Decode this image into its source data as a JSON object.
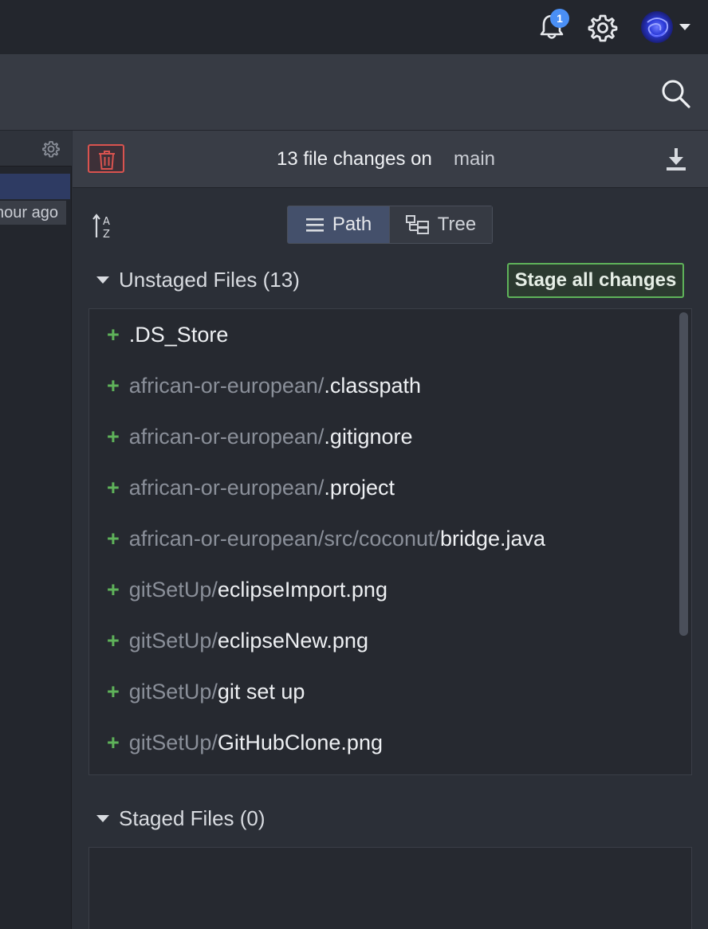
{
  "topbar": {
    "notification_count": "1"
  },
  "panel": {
    "header": {
      "changes_text": "13 file changes on",
      "branch": "main"
    },
    "view_toggle": {
      "path_label": "Path",
      "tree_label": "Tree",
      "active": "Path"
    },
    "unstaged": {
      "title": "Unstaged Files (13)",
      "stage_all_label": "Stage all changes",
      "files": [
        {
          "dir": "",
          "name": ".DS_Store"
        },
        {
          "dir": "african-or-european/",
          "name": ".classpath"
        },
        {
          "dir": "african-or-european/",
          "name": ".gitignore"
        },
        {
          "dir": "african-or-european/",
          "name": ".project"
        },
        {
          "dir": "african-or-european/src/coconut/",
          "name": "bridge.java"
        },
        {
          "dir": "gitSetUp/",
          "name": "eclipseImport.png"
        },
        {
          "dir": "gitSetUp/",
          "name": "eclipseNew.png"
        },
        {
          "dir": "gitSetUp/",
          "name": "git set up"
        },
        {
          "dir": "gitSetUp/",
          "name": "GitHubClone.png"
        }
      ]
    },
    "staged": {
      "title": "Staged Files (0)"
    }
  },
  "left": {
    "timestamp": "hour ago"
  },
  "colors": {
    "accent_green": "#5fb35a",
    "danger_red": "#d9534f",
    "badge_blue": "#4a8ff5"
  },
  "icons": [
    "bell-icon",
    "gear-icon",
    "avatar",
    "search-icon",
    "trash-icon",
    "download-icon",
    "sort-az-icon",
    "list-icon",
    "tree-icon",
    "plus-icon"
  ]
}
